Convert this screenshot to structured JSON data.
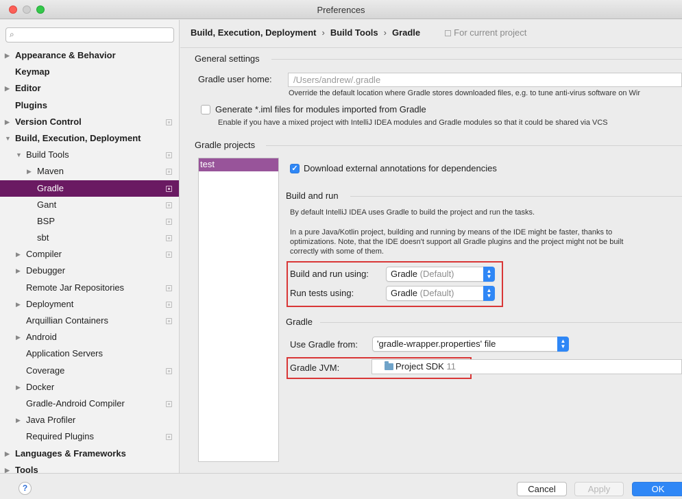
{
  "window": {
    "title": "Preferences"
  },
  "search": {
    "placeholder": ""
  },
  "sidebar": {
    "items": [
      {
        "label": "Appearance & Behavior",
        "arrow": "▶"
      },
      {
        "label": "Keymap",
        "arrow": ""
      },
      {
        "label": "Editor",
        "arrow": "▶"
      },
      {
        "label": "Plugins",
        "arrow": ""
      },
      {
        "label": "Version Control",
        "arrow": "▶"
      },
      {
        "label": "Build, Execution, Deployment",
        "arrow": "▼"
      },
      {
        "label": "Build Tools",
        "arrow": "▼"
      },
      {
        "label": "Maven",
        "arrow": "▶"
      },
      {
        "label": "Gradle",
        "arrow": ""
      },
      {
        "label": "Gant",
        "arrow": ""
      },
      {
        "label": "BSP",
        "arrow": ""
      },
      {
        "label": "sbt",
        "arrow": ""
      },
      {
        "label": "Compiler",
        "arrow": "▶"
      },
      {
        "label": "Debugger",
        "arrow": "▶"
      },
      {
        "label": "Remote Jar Repositories",
        "arrow": ""
      },
      {
        "label": "Deployment",
        "arrow": "▶"
      },
      {
        "label": "Arquillian Containers",
        "arrow": ""
      },
      {
        "label": "Android",
        "arrow": "▶"
      },
      {
        "label": "Application Servers",
        "arrow": ""
      },
      {
        "label": "Coverage",
        "arrow": ""
      },
      {
        "label": "Docker",
        "arrow": "▶"
      },
      {
        "label": "Gradle-Android Compiler",
        "arrow": ""
      },
      {
        "label": "Java Profiler",
        "arrow": "▶"
      },
      {
        "label": "Required Plugins",
        "arrow": ""
      },
      {
        "label": "Languages & Frameworks",
        "arrow": "▶"
      },
      {
        "label": "Tools",
        "arrow": "▶"
      }
    ]
  },
  "breadcrumb": {
    "part1": "Build, Execution, Deployment",
    "sep": "›",
    "part2": "Build Tools",
    "part3": "Gradle",
    "scope": "For current project"
  },
  "general": {
    "title": "General settings",
    "home_label": "Gradle user home:",
    "home_placeholder": "/Users/andrew/.gradle",
    "home_hint": "Override the default location where Gradle stores downloaded files, e.g. to tune anti-virus software on Wir",
    "iml_label": "Generate *.iml files for modules imported from Gradle",
    "iml_hint": "Enable if you have a mixed project with IntelliJ IDEA modules and Gradle modules so that it could be shared via VCS"
  },
  "projects": {
    "title": "Gradle projects",
    "items": [
      "test"
    ],
    "download_label": "Download external annotations for dependencies",
    "download_checked": "✓"
  },
  "build_run": {
    "title": "Build and run",
    "desc1": "By default IntelliJ IDEA uses Gradle to build the project and run the tasks.",
    "desc2_line1": "In a pure Java/Kotlin project, building and running by means of the IDE might be faster, thanks to",
    "desc2_line2": "optimizations. Note, that the IDE doesn't support all Gradle plugins and the project might not be built",
    "desc2_line3": "correctly with some of them.",
    "build_label": "Build and run using:",
    "build_value": "Gradle",
    "build_suffix": "(Default)",
    "tests_label": "Run tests using:",
    "tests_value": "Gradle",
    "tests_suffix": "(Default)"
  },
  "gradle": {
    "title": "Gradle",
    "use_from_label": "Use Gradle from:",
    "use_from_value": "'gradle-wrapper.properties' file",
    "jvm_label": "Gradle JVM:",
    "jvm_value": "Project SDK",
    "jvm_version": "11"
  },
  "footer": {
    "help": "?",
    "cancel": "Cancel",
    "apply": "Apply",
    "ok": "OK"
  },
  "colors": {
    "selection": "#6a1a62",
    "project_selection": "#98549a",
    "accent": "#2f87f6",
    "highlight_box": "#d93636"
  }
}
